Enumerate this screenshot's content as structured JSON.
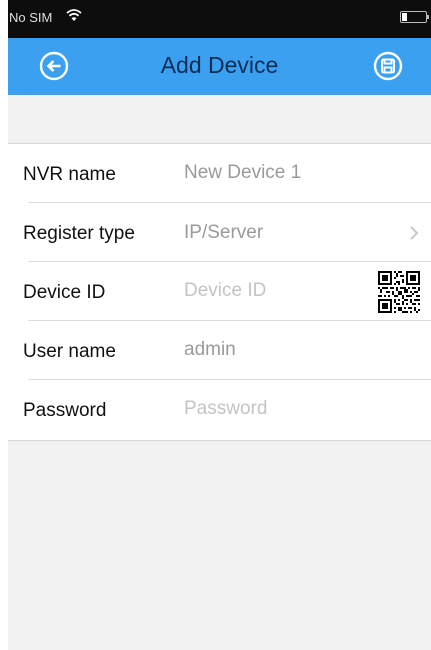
{
  "status_bar": {
    "carrier": "No SIM"
  },
  "nav": {
    "title": "Add Device",
    "back_icon": "back-arrow-icon",
    "save_icon": "save-disk-icon"
  },
  "form": {
    "nvr_name": {
      "label": "NVR name",
      "value": "New Device 1"
    },
    "register_type": {
      "label": "Register type",
      "value": "IP/Server"
    },
    "device_id": {
      "label": "Device ID",
      "placeholder": "Device ID",
      "value": ""
    },
    "user_name": {
      "label": "User name",
      "value": "admin"
    },
    "password": {
      "label": "Password",
      "placeholder": "Password",
      "value": ""
    }
  },
  "colors": {
    "nav_background": "#3ca0f0",
    "nav_text": "#0e2d55",
    "status_bar": "#0d0d0d",
    "page_background": "#f2f2f2"
  }
}
